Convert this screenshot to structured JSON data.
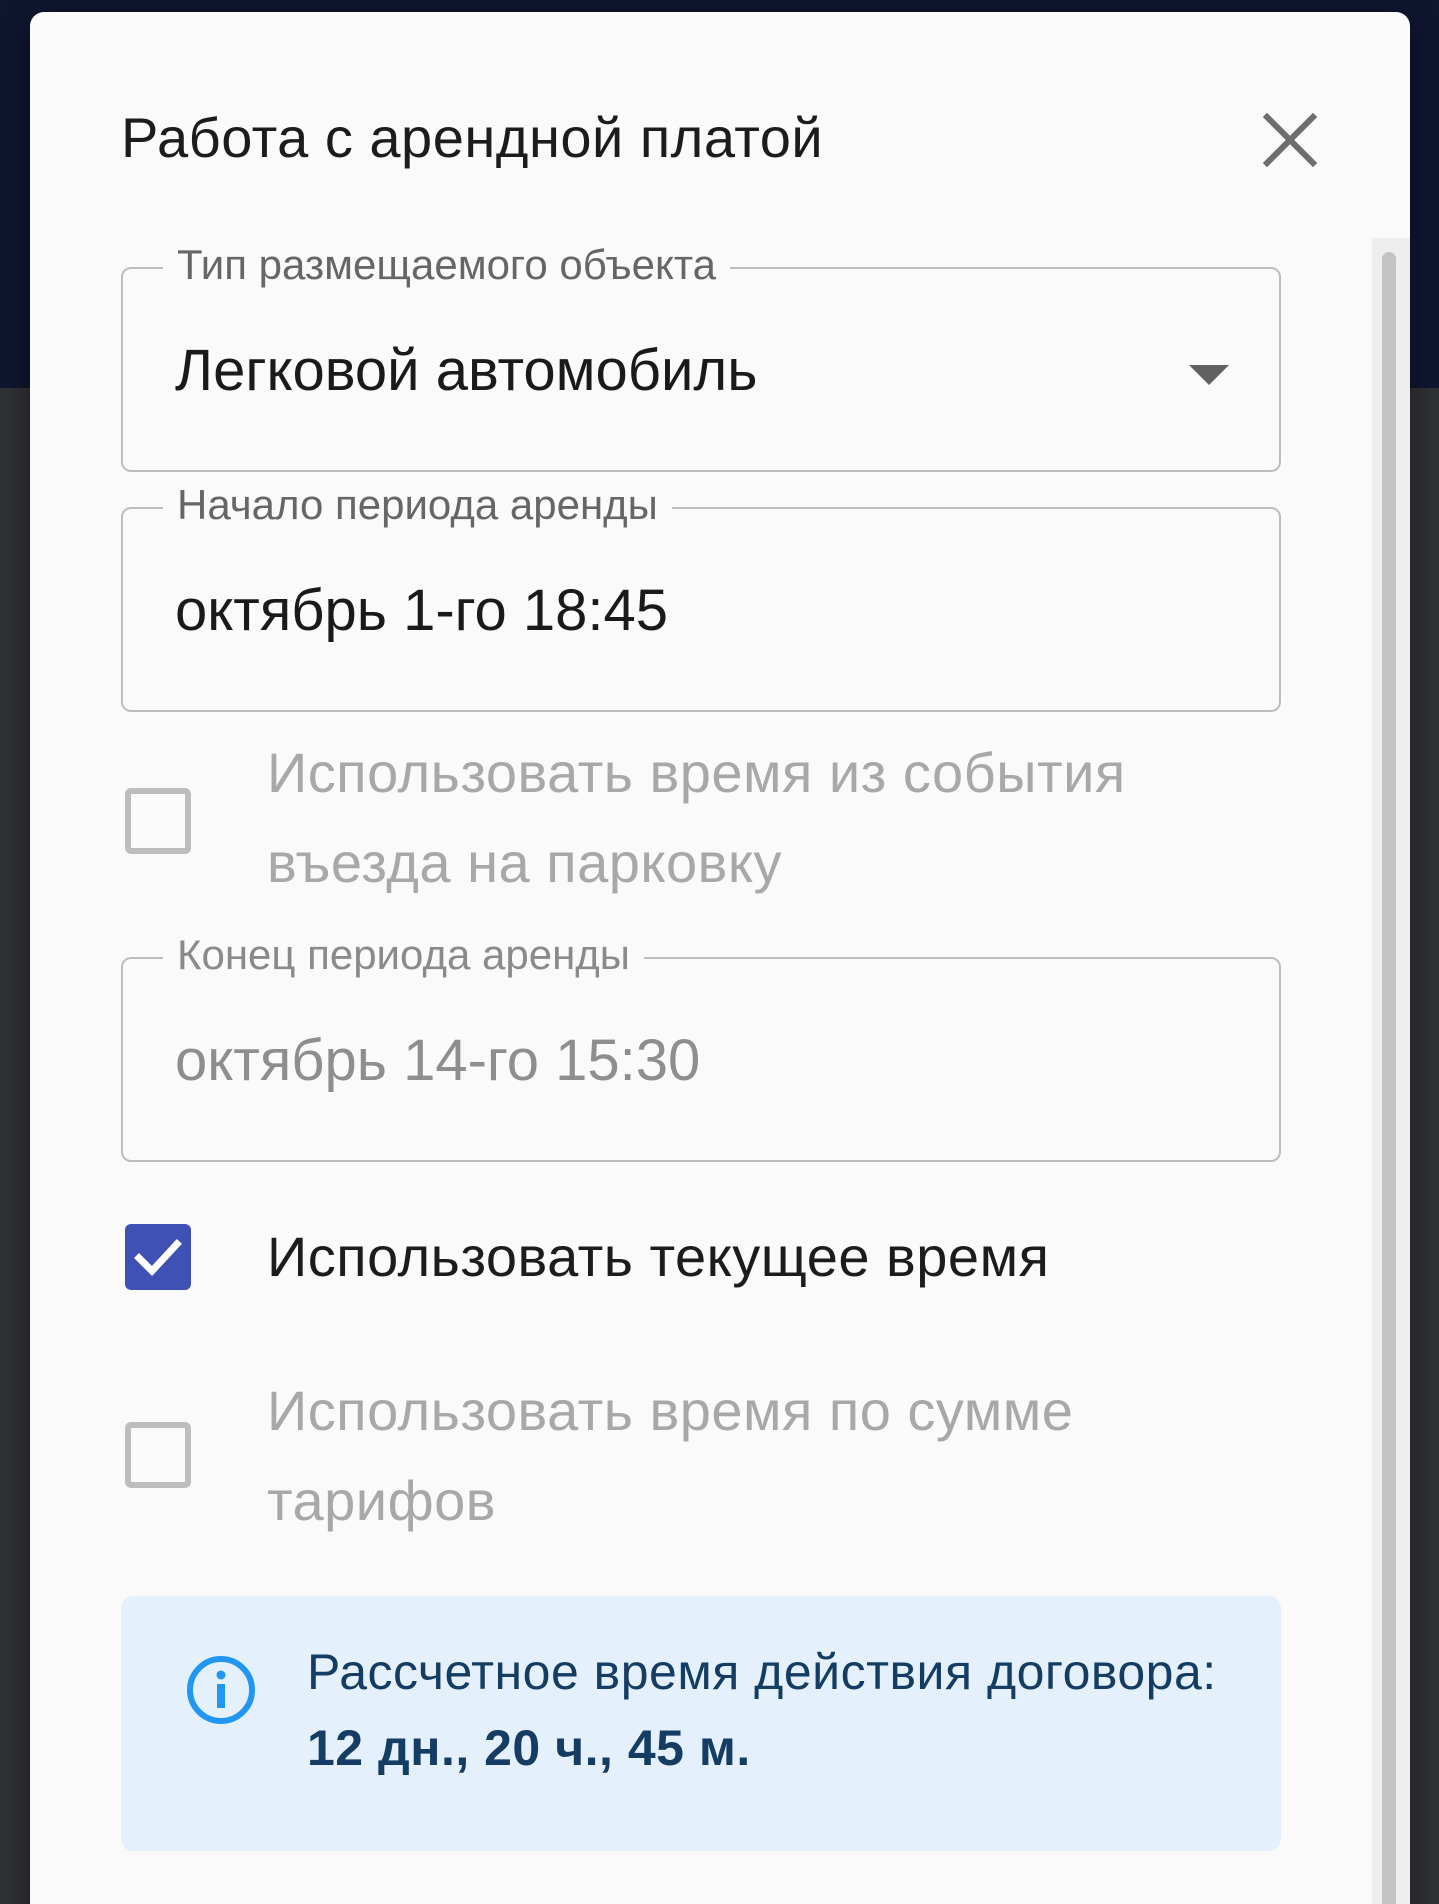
{
  "dialog": {
    "title": "Работа с арендной платой"
  },
  "fields": {
    "object_type": {
      "label": "Тип размещаемого объекта",
      "value": "Легковой автомобиль"
    },
    "period_start": {
      "label": "Начало периода аренды",
      "value": "октябрь 1-го 18:45"
    },
    "period_end": {
      "label": "Конец периода аренды",
      "value": "октябрь 14-го 15:30"
    }
  },
  "checkboxes": {
    "use_entry_event_time": {
      "label": "Использовать время из события въезда на парковку",
      "checked": false
    },
    "use_current_time": {
      "label": "Использовать текущее время",
      "checked": true
    },
    "use_tariff_sum_time": {
      "label": "Использовать время по сумме тарифов",
      "checked": false
    }
  },
  "info": {
    "text": "Рассчетное время действия договора:",
    "value": "12 дн., 20 ч., 45 м."
  },
  "colors": {
    "accent": "#3f51b5",
    "info_bg": "#e4f1fc",
    "info_text": "#153d63",
    "info_icon": "#2196f3"
  },
  "icons": {
    "close": "close-icon",
    "dropdown": "dropdown-arrow-icon",
    "check": "checkmark-icon",
    "info": "info-icon"
  }
}
